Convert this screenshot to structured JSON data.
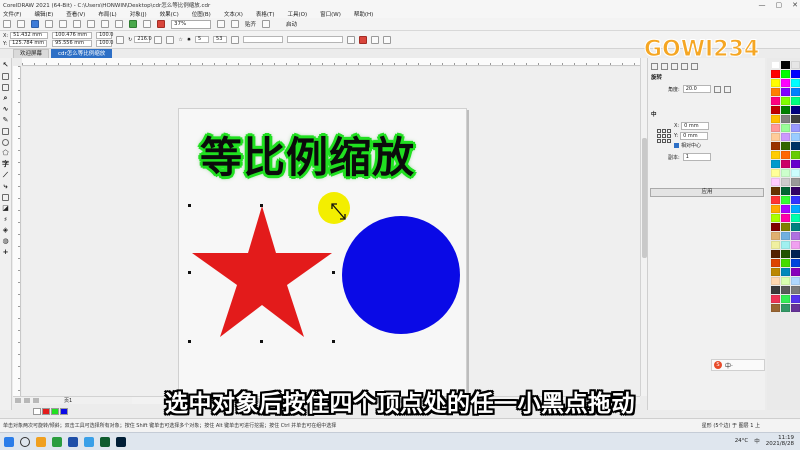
{
  "window": {
    "title": "CorelDRAW 2021 (64-Bit) - C:\\Users\\HONWIN\\Desktop\\cdr怎么等比例缩放.cdr",
    "controls": [
      "—",
      "▢",
      "✕"
    ]
  },
  "menu": [
    "文件(F)",
    "编辑(E)",
    "查看(V)",
    "布局(L)",
    "对象(J)",
    "效果(C)",
    "位图(B)",
    "文本(X)",
    "表格(T)",
    "工具(O)",
    "窗口(W)",
    "帮助(H)"
  ],
  "toolbar": {
    "zoom": "37%",
    "snap_label": "贴齐",
    "startup_label": "启动"
  },
  "propbar": {
    "x": "51.432 mm",
    "y": "125.784 mm",
    "width": "100.476 mm",
    "height": "95.556 mm",
    "scale_w": "100.0",
    "scale_h": "100.0",
    "angle": "216.0",
    "points": "5",
    "sharpness": "53"
  },
  "tabs": {
    "welcome": "欢迎屏幕",
    "document": "cdr怎么等比例缩放"
  },
  "canvas": {
    "heading": "等比例缩放"
  },
  "pagenav": {
    "label": "页1"
  },
  "docker": {
    "rotate_title": "旋转",
    "angle_label": "角度:",
    "angle_value": "20.0",
    "position_title": "中",
    "x_label": "X:",
    "x_value": "0 mm",
    "y_label": "Y:",
    "y_value": "0 mm",
    "relative_label": "相对中心",
    "copies_label": "副本:",
    "copies_value": "1",
    "apply_label": "应用"
  },
  "watermark": "GOWI234",
  "subtitle": "选中对象后按住四个顶点处的任一小黑点拖动",
  "ime": {
    "logo": "S",
    "label": "中·"
  },
  "status": {
    "left_text": "单击对象两次可旋转/倾斜；双击工具可选择所有对象；按住 Shift 键单击可选择多个对象；按住 Alt 键单击可进行挖掘；按住 Ctrl 并单击可在组中选择",
    "right_text": "星形 (5个边) 于 图层 1 上"
  },
  "taskbar": {
    "temperature": "24°C",
    "ime_tray": "中",
    "time": "11:19",
    "date": "2021/8/28"
  },
  "colors": {
    "star": "#e31b1b",
    "circle": "#0a0ae6",
    "heading_outline": "#21e021",
    "cursor_highlight": "#f3ee00",
    "accent": "#2d6fc6"
  },
  "palette": [
    "#ffffff",
    "#000000",
    "#e6e6e6",
    "#ff0000",
    "#00ff00",
    "#0000ff",
    "#ffff00",
    "#ff00ff",
    "#00ffff",
    "#ff8000",
    "#8000ff",
    "#0080ff",
    "#ff0080",
    "#80ff00",
    "#00ff80",
    "#c00000",
    "#008000",
    "#000080",
    "#ffc000",
    "#808080",
    "#404040",
    "#ff9999",
    "#99ff99",
    "#9999ff",
    "#ffcc99",
    "#cc99ff",
    "#99ccff",
    "#993300",
    "#336600",
    "#003366",
    "#ffcc00",
    "#ff6600",
    "#66cc00",
    "#0099cc",
    "#cc0066",
    "#6600cc",
    "#ffff99",
    "#ccffcc",
    "#ccffff",
    "#ffccff",
    "#cccccc",
    "#999999",
    "#663300",
    "#006633",
    "#330066",
    "#ff3333",
    "#33ff33",
    "#3333ff",
    "#ffaa00",
    "#aa00ff",
    "#00aaff",
    "#aaff00",
    "#ff00aa",
    "#00ffaa",
    "#800000",
    "#808000",
    "#008080",
    "#e0b070",
    "#70b0e0",
    "#b070e0",
    "#f0f0a0",
    "#a0f0f0",
    "#f0a0f0",
    "#552200",
    "#225500",
    "#002255",
    "#dd4400",
    "#44dd00",
    "#0044dd",
    "#bb8800",
    "#0088bb",
    "#8800bb",
    "#ffd8b0",
    "#d8ffb0",
    "#b0d8ff",
    "#3a3a3a",
    "#5a5a5a",
    "#7a7a7a",
    "#ee3355",
    "#33ee55",
    "#5533ee",
    "#996633",
    "#339966",
    "#663399"
  ],
  "docbar_colors": [
    "#ffffff",
    "#e31b1b",
    "#21e021",
    "#0a0ae6"
  ]
}
